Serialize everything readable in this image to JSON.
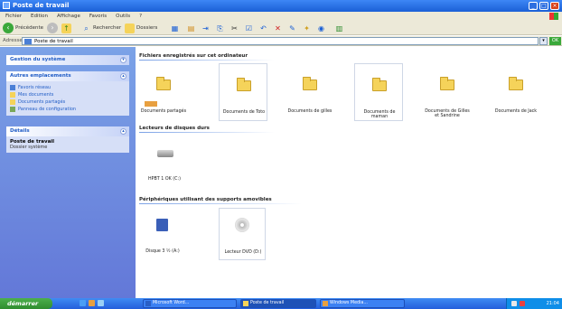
{
  "window": {
    "title": "Poste de travail",
    "minimize_label": "_",
    "maximize_label": "□",
    "close_label": "×"
  },
  "menubar": {
    "items": [
      "Fichier",
      "Edition",
      "Affichage",
      "Favoris",
      "Outils",
      "?"
    ]
  },
  "toolbar": {
    "back_label": "Précédente",
    "search_label": "Rechercher",
    "folders_label": "Dossiers"
  },
  "address": {
    "label": "Adresse",
    "value": "Poste de travail",
    "go_label": "OK"
  },
  "left_pane": {
    "system_tasks": {
      "title": "Gestion du système"
    },
    "other_places": {
      "title": "Autres emplacements",
      "items": [
        "Favoris réseau",
        "Mes documents",
        "Documents partagés",
        "Panneau de configuration"
      ]
    },
    "details": {
      "title": "Détails",
      "name": "Poste de travail",
      "type": "Dossier système"
    }
  },
  "content": {
    "group1_title": "Fichiers enregistrés sur cet ordinateur",
    "folders": [
      "Documents partagés",
      "Documents de Toto",
      "Documents de gilles",
      "Documents de maman",
      "Documents de Gilles et Sandrine",
      "Documents de Jack"
    ],
    "group2_title": "Lecteurs de disques durs",
    "hard_drives": [
      "HPBT 1 OK (C:)"
    ],
    "group3_title": "Périphériques utilisant des supports amovibles",
    "removable": [
      "Disque 3 ½ (A:)",
      "Lecteur DVD (D:)"
    ]
  },
  "taskbar": {
    "start_label": "démarrer",
    "tasks": [
      "Microsoft Word...",
      "Poste de travail",
      "Windows Media..."
    ],
    "clock": "21:04"
  }
}
